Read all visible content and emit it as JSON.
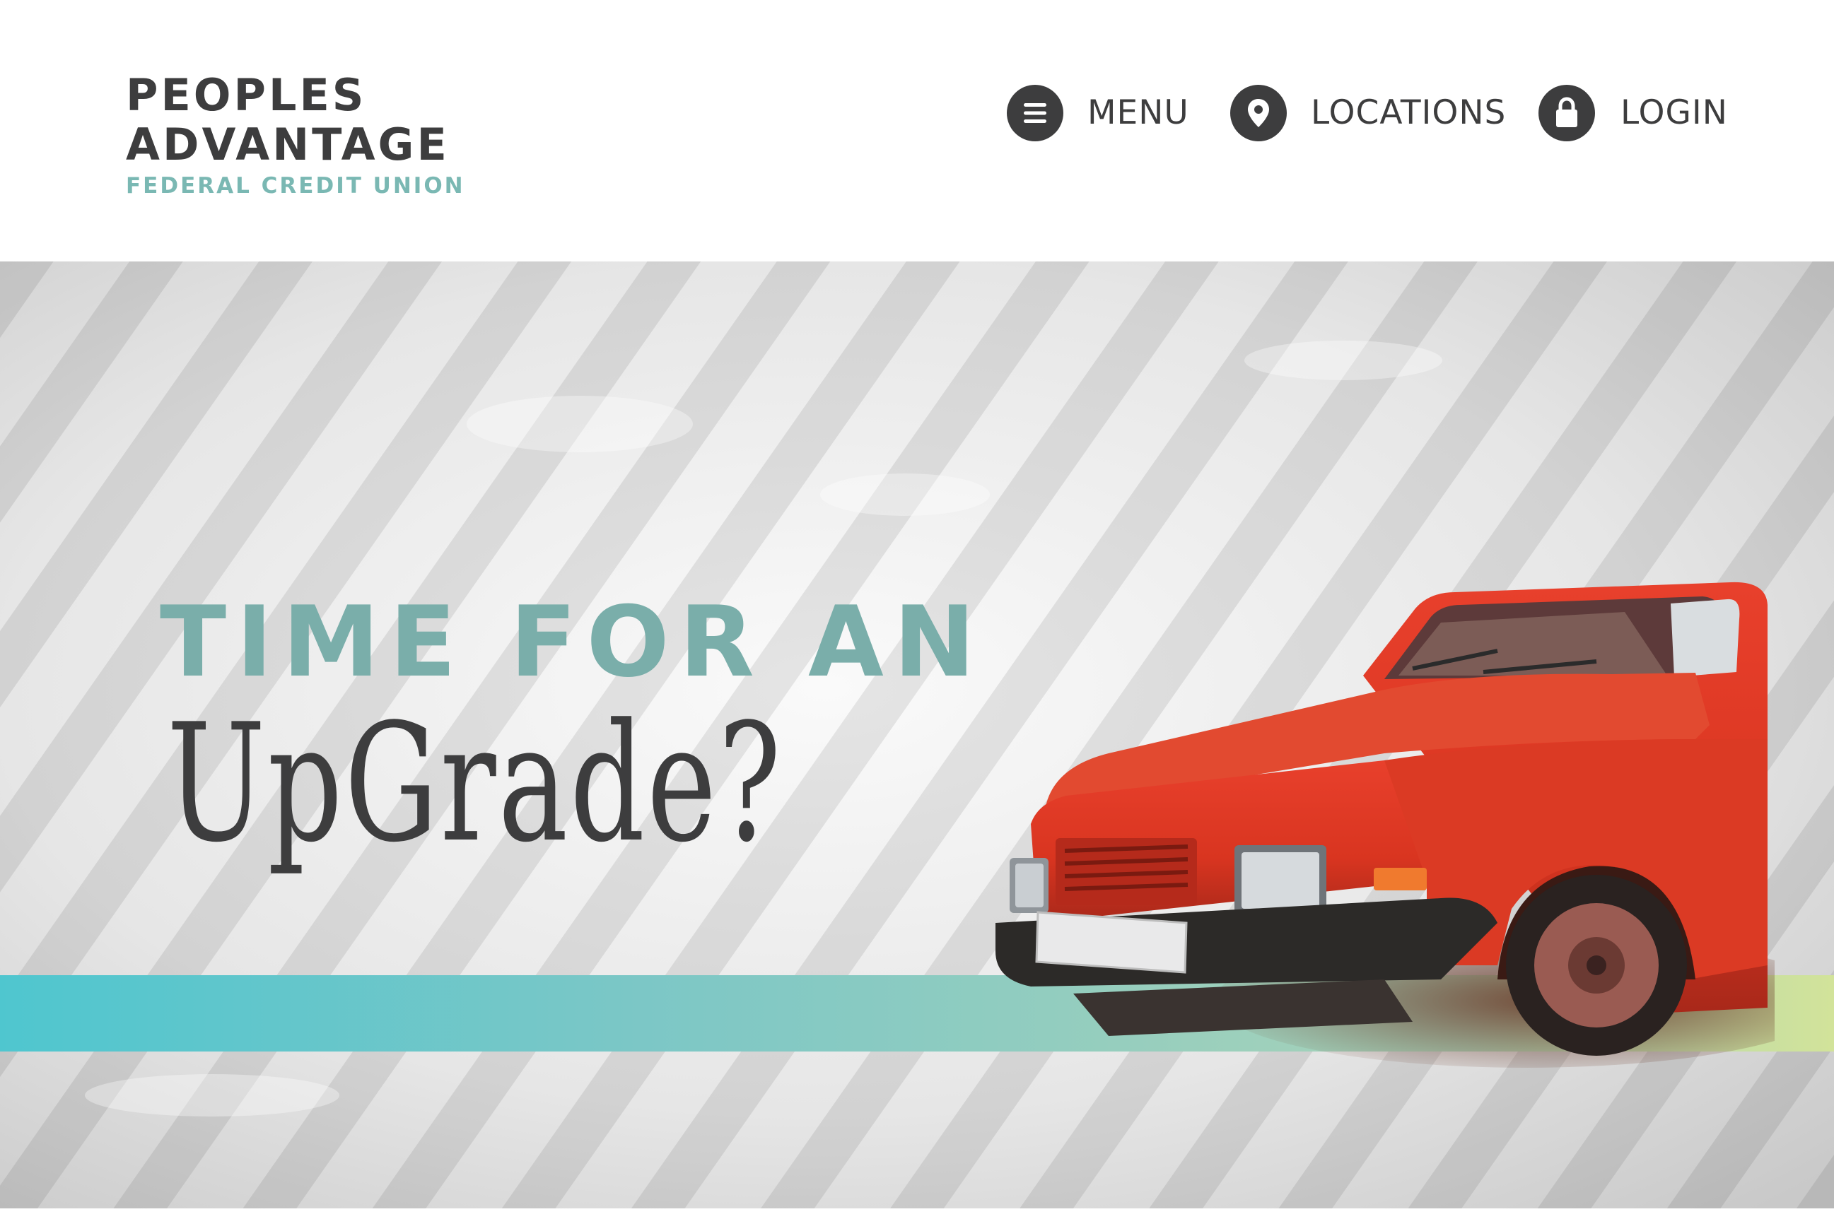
{
  "brand": {
    "line1": "PEOPLES",
    "line2": "ADVANTAGE",
    "line3": "FEDERAL CREDIT UNION",
    "colors": {
      "dark": "#3d3d3e",
      "teal": "#7ab8b3",
      "check_red": "#d7262e"
    }
  },
  "nav": {
    "menu": {
      "label": "MENU",
      "icon": "hamburger-icon"
    },
    "locations": {
      "label": "LOCATIONS",
      "icon": "map-pin-icon"
    },
    "login": {
      "label": "LOGIN",
      "icon": "lock-icon"
    }
  },
  "hero": {
    "headline_top": "TIME FOR AN",
    "headline_bottom": "UpGrade?",
    "image": "red-car",
    "colors": {
      "headline_teal": "#7aaeaa",
      "band_start": "#4fc6cf",
      "band_end": "#cfe29b"
    }
  }
}
